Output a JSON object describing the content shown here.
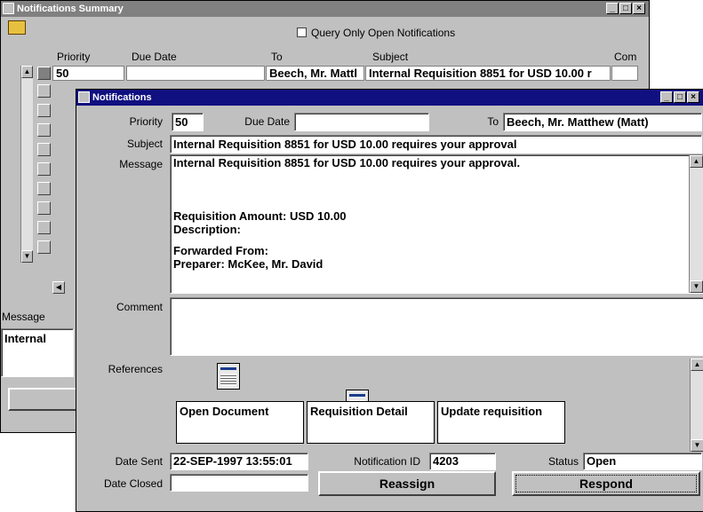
{
  "summary": {
    "title": "Notifications Summary",
    "query_only_label": "Query Only Open Notifications",
    "columns": [
      "Priority",
      "Due Date",
      "To",
      "Subject",
      "Com"
    ],
    "row1": {
      "priority": "50",
      "due_date": "",
      "to": "Beech, Mr. Mattl",
      "subject": "Internal Requisition 8851 for  USD 10.00 r"
    },
    "message_label": "Message",
    "message_value": "Internal"
  },
  "detail": {
    "title": "Notifications",
    "priority_label": "Priority",
    "priority_value": "50",
    "due_date_label": "Due Date",
    "due_date_value": "",
    "to_label": "To",
    "to_value": "Beech, Mr. Matthew (Matt)",
    "subject_label": "Subject",
    "subject_value": "Internal Requisition 8851 for  USD 10.00 requires your approval",
    "message_label": "Message",
    "message_lines": [
      "Internal Requisition  8851 for USD 10.00 requires your approval.",
      "",
      "",
      "",
      "Requisition Amount: USD  10.00",
      "Description:",
      "",
      "Forwarded From:",
      "Preparer: McKee, Mr. David"
    ],
    "comment_label": "Comment",
    "comment_value": "",
    "references_label": "References",
    "references": [
      {
        "label": "Open Document",
        "icon": "document-icon"
      },
      {
        "label": "Requisition Detail",
        "icon": "form-icon"
      },
      {
        "label": "Update requisition",
        "icon": "form-icon"
      }
    ],
    "date_sent_label": "Date Sent",
    "date_sent_value": "22-SEP-1997 13:55:01",
    "notification_id_label": "Notification ID",
    "notification_id_value": "4203",
    "status_label": "Status",
    "status_value": "Open",
    "date_closed_label": "Date Closed",
    "date_closed_value": "",
    "reassign_label": "Reassign",
    "respond_label": "Respond"
  }
}
